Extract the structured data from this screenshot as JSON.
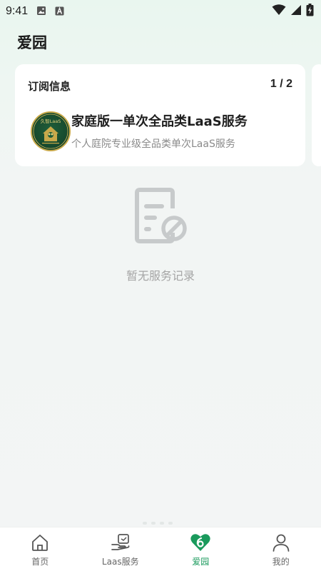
{
  "status_bar": {
    "time": "9:41",
    "left_icons": [
      "image-icon",
      "font-a-icon"
    ],
    "right_icons": [
      "wifi-icon",
      "signal-icon",
      "battery-charging-icon"
    ]
  },
  "header": {
    "title": "爱园"
  },
  "subscription_card": {
    "label": "订阅信息",
    "pager": "1 / 2",
    "logo_text": "久智LaaS",
    "title": "家庭版一单次全品类LaaS服务",
    "subtitle": "个人庭院专业级全品类单次LaaS服务"
  },
  "empty_state": {
    "icon": "no-record-document-icon",
    "text": "暂无服务记录"
  },
  "bottom_nav": {
    "items": [
      {
        "label": "首页",
        "icon": "home-icon",
        "active": false
      },
      {
        "label": "Laas服务",
        "icon": "hand-service-icon",
        "active": false
      },
      {
        "label": "爱园",
        "icon": "garden-heart-icon",
        "active": true
      },
      {
        "label": "我的",
        "icon": "person-icon",
        "active": false
      }
    ]
  },
  "colors": {
    "accent": "#1a9a5c",
    "page_bg_top": "#e9f6ef",
    "card_bg": "#ffffff",
    "muted_text": "#a5a5a5"
  }
}
